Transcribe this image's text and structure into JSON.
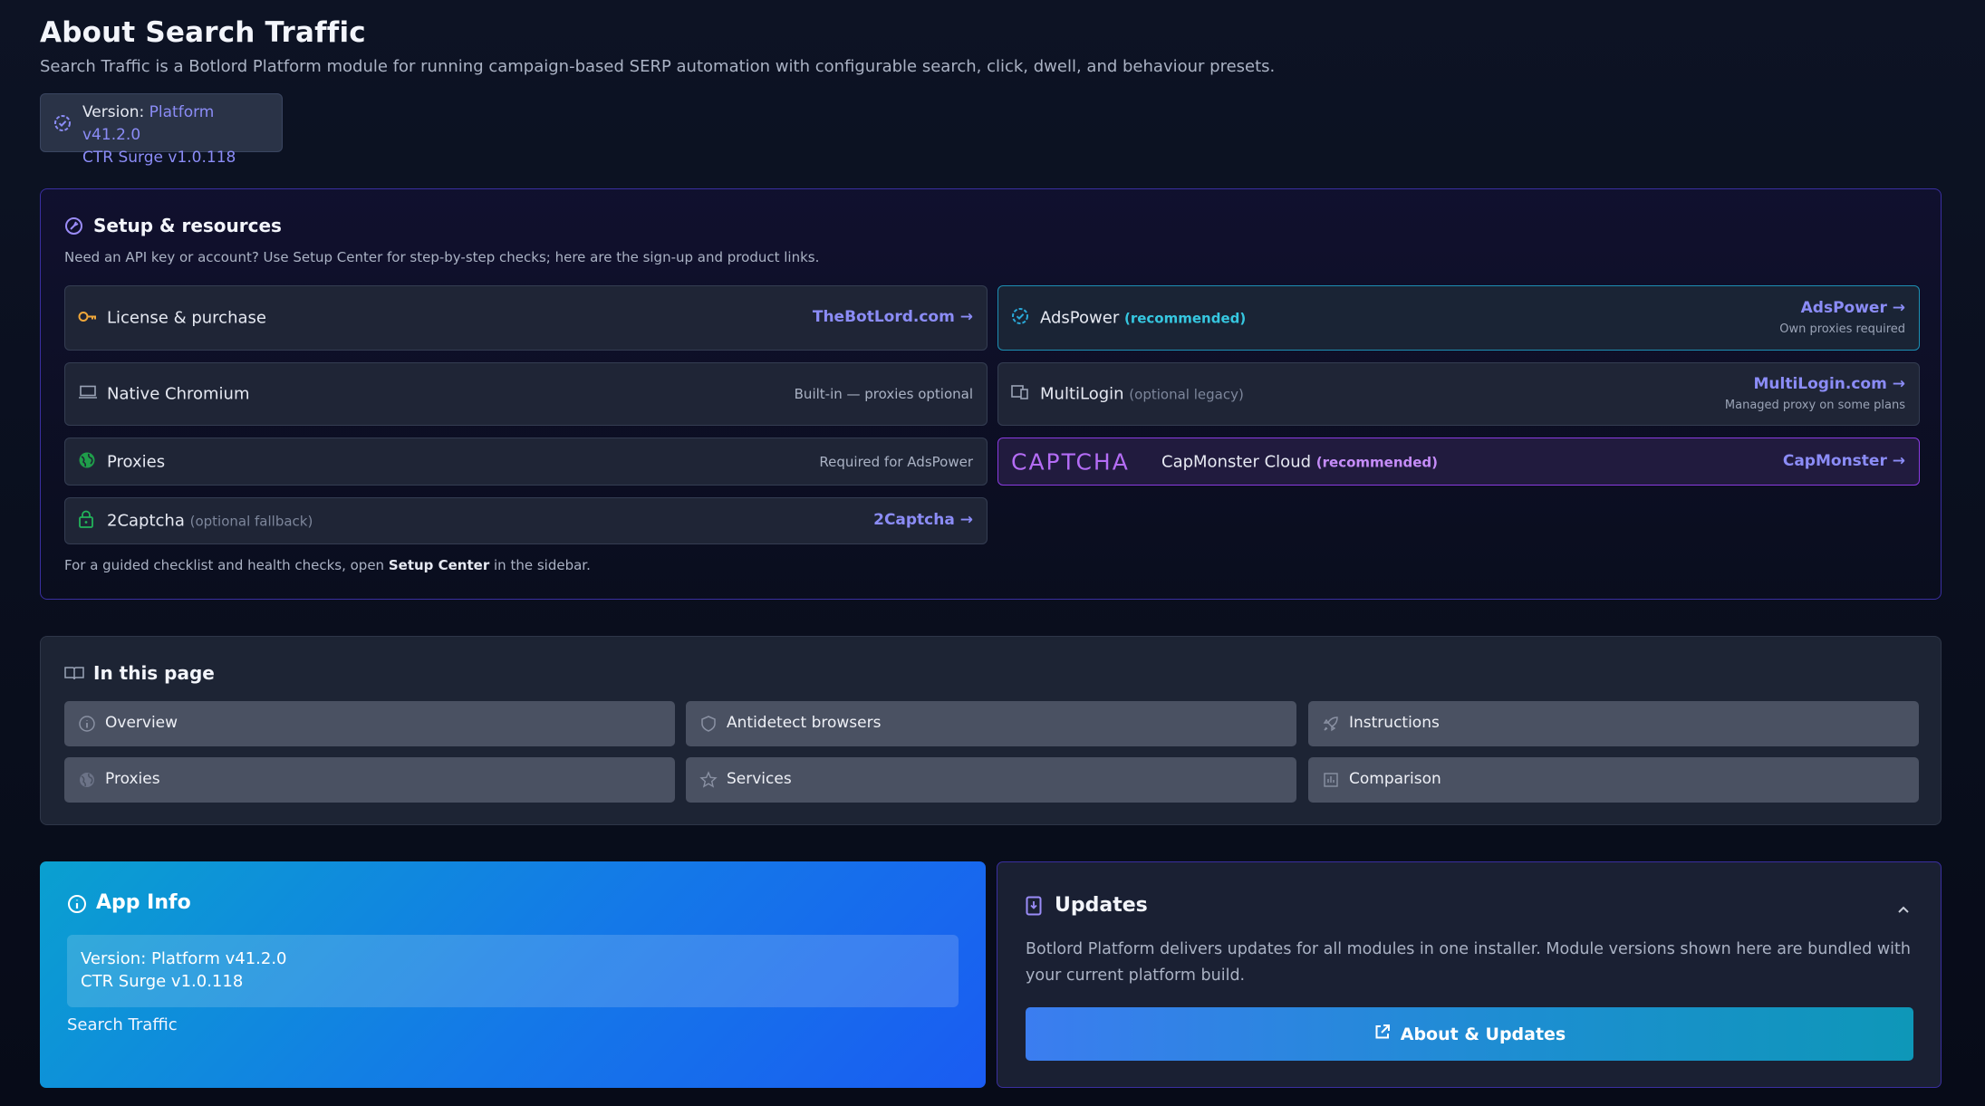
{
  "header": {
    "title": "About Search Traffic",
    "subtitle": "Search Traffic is a Botlord Platform module for running campaign-based SERP automation with configurable search, click, dwell, and behaviour presets.",
    "version_label": "Version:",
    "version_platform": "Platform v41.2.0",
    "version_module": "CTR Surge v1.0.118"
  },
  "setup": {
    "title": "Setup & resources",
    "description": "Need an API key or account? Use Setup Center for step-by-step checks; here are the sign-up and product links.",
    "cards": {
      "license": {
        "label": "License & purchase",
        "link": "TheBotLord.com →",
        "icon": "key-icon"
      },
      "adspower": {
        "label": "AdsPower",
        "badge": "(recommended)",
        "link": "AdsPower →",
        "sub": "Own proxies required",
        "icon": "check-circle-icon"
      },
      "chromium": {
        "label": "Native Chromium",
        "right": "Built-in — proxies optional",
        "icon": "laptop-icon"
      },
      "multilogin": {
        "label": "MultiLogin",
        "note": "(optional legacy)",
        "link": "MultiLogin.com →",
        "sub": "Managed proxy on some plans",
        "icon": "devices-icon"
      },
      "proxies": {
        "label": "Proxies",
        "right": "Required for AdsPower",
        "icon": "globe-icon"
      },
      "capmonster": {
        "logo": "CAPTCHA",
        "label": "CapMonster Cloud",
        "badge": "(recommended)",
        "link": "CapMonster →"
      },
      "twocaptcha": {
        "label": "2Captcha",
        "note": "(optional fallback)",
        "link": "2Captcha →",
        "icon": "lock-icon"
      }
    },
    "footer_prefix": "For a guided checklist and health checks, open",
    "footer_strong": "Setup Center",
    "footer_suffix": "in the sidebar."
  },
  "toc": {
    "title": "In this page",
    "items": [
      {
        "label": "Overview",
        "icon": "info-icon"
      },
      {
        "label": "Antidetect browsers",
        "icon": "shield-icon"
      },
      {
        "label": "Instructions",
        "icon": "rocket-icon"
      },
      {
        "label": "Proxies",
        "icon": "globe-icon"
      },
      {
        "label": "Services",
        "icon": "star-icon"
      },
      {
        "label": "Comparison",
        "icon": "table-icon"
      }
    ]
  },
  "app_info": {
    "title": "App Info",
    "version_line1": "Version: Platform v41.2.0",
    "version_line2": "CTR Surge v1.0.118",
    "module": "Search Traffic"
  },
  "updates": {
    "title": "Updates",
    "text": "Botlord Platform delivers updates for all modules in one installer. Module versions shown here are bundled with your current platform build.",
    "button": "About & Updates"
  },
  "colors": {
    "accent_link": "#8b8cf6",
    "adspower_border": "#1d8fb3",
    "capmonster_border": "#8a3be0",
    "app_info_gradient_start": "#0aa0d0",
    "app_info_gradient_end": "#1a5cf2"
  }
}
